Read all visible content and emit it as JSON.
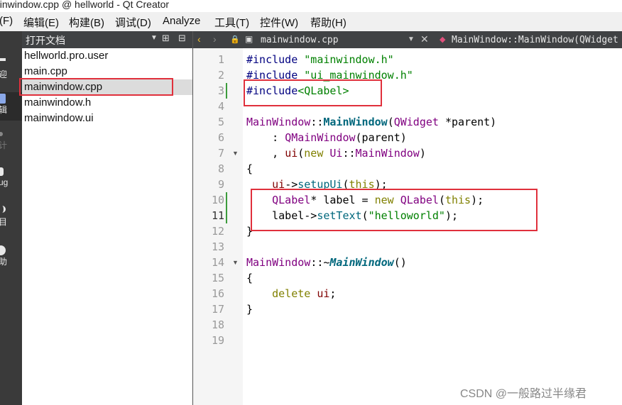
{
  "window": {
    "title": "ainwindow.cpp @ hellworld - Qt Creator"
  },
  "menu": [
    {
      "id": "file",
      "label": "(F)"
    },
    {
      "id": "edit",
      "label": "编辑(E)"
    },
    {
      "id": "build",
      "label": "构建(B)"
    },
    {
      "id": "debug",
      "label": "调试(D)"
    },
    {
      "id": "analyze",
      "label": "Analyze"
    },
    {
      "id": "tools",
      "label": "工具(T)"
    },
    {
      "id": "controls",
      "label": "控件(W)"
    },
    {
      "id": "help",
      "label": "帮助(H)"
    }
  ],
  "modes": [
    {
      "id": "welcome",
      "label": "迎",
      "icon": "welcome-icon"
    },
    {
      "id": "edit",
      "label": "辑",
      "icon": "edit-icon",
      "active": true
    },
    {
      "id": "design",
      "label": "计",
      "icon": "design-icon"
    },
    {
      "id": "debug",
      "label": "ug",
      "icon": "debug-icon"
    },
    {
      "id": "projects",
      "label": "目",
      "icon": "projects-icon"
    },
    {
      "id": "help",
      "label": "助",
      "icon": "help-icon"
    }
  ],
  "open_docs": {
    "title": "打开文档",
    "files": [
      {
        "name": "hellworld.pro.user",
        "selected": false
      },
      {
        "name": "main.cpp",
        "selected": false
      },
      {
        "name": "mainwindow.cpp",
        "selected": true
      },
      {
        "name": "mainwindow.h",
        "selected": false
      },
      {
        "name": "mainwindow.ui",
        "selected": false
      }
    ]
  },
  "editor": {
    "current_file": "mainwindow.cpp",
    "symbol": "MainWindow::MainWindow(QWidget *parent)",
    "current_line": 11,
    "lines": [
      {
        "n": "1",
        "tokens": [
          [
            "#include ",
            "#000080"
          ],
          [
            "\"mainwindow.h\"",
            "#008000"
          ]
        ]
      },
      {
        "n": "2",
        "tokens": [
          [
            "#include ",
            "#000080"
          ],
          [
            "\"ui_mainwindow.h\"",
            "#008000"
          ]
        ]
      },
      {
        "n": "3",
        "tokens": [
          [
            "#include",
            "#000080"
          ],
          [
            "<QLabel>",
            "#008000"
          ]
        ],
        "changed": true
      },
      {
        "n": "4",
        "tokens": []
      },
      {
        "n": "5",
        "tokens": [
          [
            "MainWindow",
            "#800080"
          ],
          [
            "::",
            "#000000"
          ],
          [
            "MainWindow",
            "#00677c",
            "bold"
          ],
          [
            "(",
            "#000000"
          ],
          [
            "QWidget",
            "#800080"
          ],
          [
            " *parent)",
            "#000000"
          ]
        ]
      },
      {
        "n": "6",
        "tokens": [
          [
            "    : ",
            "#000000"
          ],
          [
            "QMainWindow",
            "#800080"
          ],
          [
            "(parent)",
            "#000000"
          ]
        ]
      },
      {
        "n": "7",
        "tokens": [
          [
            "    , ",
            "#000000"
          ],
          [
            "ui",
            "#800000"
          ],
          [
            "(",
            "#000000"
          ],
          [
            "new ",
            "#808000"
          ],
          [
            "Ui",
            "#800080"
          ],
          [
            "::",
            "#000000"
          ],
          [
            "MainWindow",
            "#800080"
          ],
          [
            ")",
            "#000000"
          ]
        ],
        "fold": true
      },
      {
        "n": "8",
        "tokens": [
          [
            "{",
            "#000000"
          ]
        ]
      },
      {
        "n": "9",
        "tokens": [
          [
            "    ",
            "#000000"
          ],
          [
            "ui",
            "#800000"
          ],
          [
            "->",
            "#000000"
          ],
          [
            "setupUi",
            "#00677c"
          ],
          [
            "(",
            "#000000"
          ],
          [
            "this",
            "#808000"
          ],
          [
            ");",
            "#000000"
          ]
        ]
      },
      {
        "n": "10",
        "tokens": [
          [
            "    ",
            "#000000"
          ],
          [
            "QLabel",
            "#800080"
          ],
          [
            "* label = ",
            "#000000"
          ],
          [
            "new ",
            "#808000"
          ],
          [
            "QLabel",
            "#800080"
          ],
          [
            "(",
            "#000000"
          ],
          [
            "this",
            "#808000"
          ],
          [
            ");",
            "#000000"
          ]
        ],
        "changed": true
      },
      {
        "n": "11",
        "tokens": [
          [
            "    label->",
            "#000000"
          ],
          [
            "setText",
            "#00677c"
          ],
          [
            "(",
            "#000000"
          ],
          [
            "\"helloworld\"",
            "#008000"
          ],
          [
            ");",
            "#000000"
          ]
        ],
        "changed": true
      },
      {
        "n": "12",
        "tokens": [
          [
            "}",
            "#000000"
          ]
        ]
      },
      {
        "n": "13",
        "tokens": []
      },
      {
        "n": "14",
        "tokens": [
          [
            "MainWindow",
            "#800080"
          ],
          [
            "::~",
            "#000000"
          ],
          [
            "MainWindow",
            "#00677c",
            "bolditalic"
          ],
          [
            "()",
            "#000000"
          ]
        ],
        "fold": true
      },
      {
        "n": "15",
        "tokens": [
          [
            "{",
            "#000000"
          ]
        ]
      },
      {
        "n": "16",
        "tokens": [
          [
            "    ",
            "#000000"
          ],
          [
            "delete ",
            "#808000"
          ],
          [
            "ui",
            "#800000"
          ],
          [
            ";",
            "#000000"
          ]
        ]
      },
      {
        "n": "17",
        "tokens": [
          [
            "}",
            "#000000"
          ]
        ]
      },
      {
        "n": "18",
        "tokens": []
      },
      {
        "n": "19",
        "tokens": []
      }
    ]
  },
  "annotations": [
    {
      "id": "highlight-include",
      "color": "#e0303c"
    },
    {
      "id": "highlight-label-code",
      "color": "#e0303c"
    },
    {
      "id": "highlight-selected-file",
      "color": "#e0303c"
    }
  ],
  "watermark": "CSDN @一般路过半缘君"
}
